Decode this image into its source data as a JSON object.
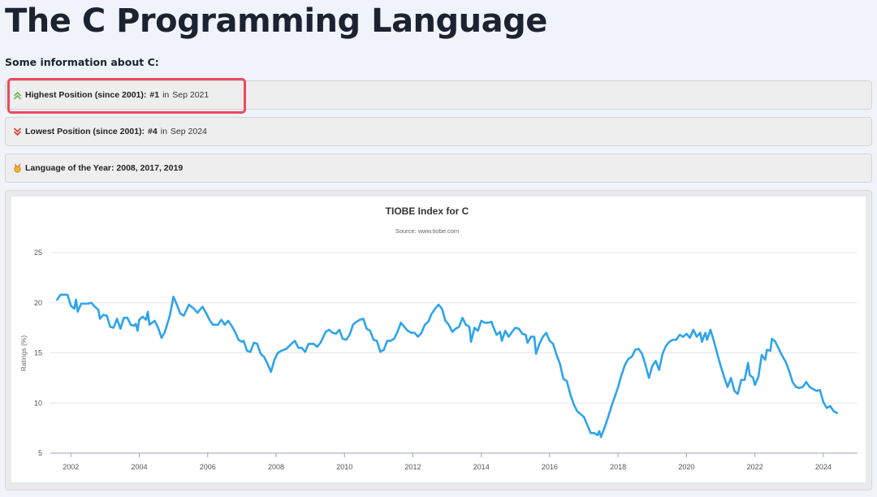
{
  "page": {
    "title": "The C Programming Language",
    "section_heading": "Some information about C:"
  },
  "info": {
    "highest": {
      "label": "Highest Position (since 2001):",
      "value": "#1",
      "in": "in",
      "date": "Sep 2021"
    },
    "lowest": {
      "label": "Lowest Position (since 2001):",
      "value": "#4",
      "in": "in",
      "date": "Sep 2024"
    },
    "year": {
      "label": "Language of the Year: 2008, 2017, 2019"
    }
  },
  "icons": {
    "highest": "double-chevron-up-icon",
    "lowest": "double-chevron-down-icon",
    "year": "medal-icon"
  },
  "colors": {
    "up": "#6cc04a",
    "down": "#e0463b",
    "line": "#2ea4ec",
    "highlight": "#ec4a5d"
  },
  "chart_data": {
    "type": "line",
    "title": "TIOBE Index for C",
    "subtitle": "Source: www.tiobe.com",
    "ylabel": "Ratings (%)",
    "xlabel": "",
    "ylim": [
      5,
      25
    ],
    "xlim": [
      2001.4,
      2025.0
    ],
    "yticks": [
      5,
      10,
      15,
      20,
      25
    ],
    "xticks": [
      2002,
      2004,
      2006,
      2008,
      2010,
      2012,
      2014,
      2016,
      2018,
      2020,
      2022,
      2024
    ],
    "grid": true,
    "series": [
      {
        "name": "",
        "points": [
          [
            2001.6,
            20.3
          ],
          [
            2001.7,
            20.8
          ],
          [
            2001.9,
            20.8
          ],
          [
            2002.0,
            19.7
          ],
          [
            2002.1,
            19.4
          ],
          [
            2002.15,
            20.3
          ],
          [
            2002.2,
            19.1
          ],
          [
            2002.3,
            19.9
          ],
          [
            2002.5,
            19.9
          ],
          [
            2002.6,
            20.0
          ],
          [
            2002.7,
            19.6
          ],
          [
            2002.8,
            19.3
          ],
          [
            2002.85,
            18.4
          ],
          [
            2002.95,
            18.8
          ],
          [
            2003.05,
            18.7
          ],
          [
            2003.15,
            17.6
          ],
          [
            2003.25,
            17.5
          ],
          [
            2003.35,
            18.4
          ],
          [
            2003.45,
            17.4
          ],
          [
            2003.55,
            18.5
          ],
          [
            2003.65,
            18.5
          ],
          [
            2003.75,
            17.8
          ],
          [
            2003.85,
            17.7
          ],
          [
            2003.9,
            17.9
          ],
          [
            2003.95,
            17.2
          ],
          [
            2004.0,
            18.3
          ],
          [
            2004.1,
            18.6
          ],
          [
            2004.2,
            18.3
          ],
          [
            2004.25,
            19.1
          ],
          [
            2004.3,
            17.8
          ],
          [
            2004.45,
            18.2
          ],
          [
            2004.55,
            17.5
          ],
          [
            2004.65,
            16.5
          ],
          [
            2004.75,
            17.1
          ],
          [
            2004.9,
            18.8
          ],
          [
            2005.0,
            20.6
          ],
          [
            2005.1,
            19.8
          ],
          [
            2005.2,
            18.9
          ],
          [
            2005.3,
            18.7
          ],
          [
            2005.45,
            19.8
          ],
          [
            2005.6,
            19.4
          ],
          [
            2005.7,
            19.0
          ],
          [
            2005.85,
            19.6
          ],
          [
            2005.95,
            19.0
          ],
          [
            2006.05,
            18.3
          ],
          [
            2006.15,
            17.8
          ],
          [
            2006.3,
            17.8
          ],
          [
            2006.4,
            18.3
          ],
          [
            2006.5,
            17.8
          ],
          [
            2006.6,
            18.2
          ],
          [
            2006.7,
            17.7
          ],
          [
            2006.8,
            17.1
          ],
          [
            2006.9,
            16.3
          ],
          [
            2007.0,
            16.1
          ],
          [
            2007.05,
            16.2
          ],
          [
            2007.15,
            15.2
          ],
          [
            2007.25,
            15.1
          ],
          [
            2007.35,
            16.0
          ],
          [
            2007.45,
            15.9
          ],
          [
            2007.55,
            14.9
          ],
          [
            2007.65,
            14.6
          ],
          [
            2007.75,
            13.9
          ],
          [
            2007.85,
            13.1
          ],
          [
            2007.95,
            14.3
          ],
          [
            2008.05,
            15.0
          ],
          [
            2008.15,
            15.2
          ],
          [
            2008.3,
            15.4
          ],
          [
            2008.45,
            15.9
          ],
          [
            2008.55,
            16.2
          ],
          [
            2008.65,
            15.5
          ],
          [
            2008.75,
            15.5
          ],
          [
            2008.85,
            15.1
          ],
          [
            2008.95,
            15.9
          ],
          [
            2009.1,
            15.9
          ],
          [
            2009.2,
            15.6
          ],
          [
            2009.3,
            16.0
          ],
          [
            2009.45,
            17.1
          ],
          [
            2009.55,
            17.3
          ],
          [
            2009.65,
            17.0
          ],
          [
            2009.75,
            16.9
          ],
          [
            2009.85,
            17.3
          ],
          [
            2009.95,
            16.4
          ],
          [
            2010.05,
            16.3
          ],
          [
            2010.15,
            16.8
          ],
          [
            2010.25,
            17.8
          ],
          [
            2010.35,
            18.1
          ],
          [
            2010.45,
            18.3
          ],
          [
            2010.55,
            18.4
          ],
          [
            2010.65,
            17.4
          ],
          [
            2010.75,
            17.2
          ],
          [
            2010.85,
            16.3
          ],
          [
            2010.95,
            16.2
          ],
          [
            2011.05,
            15.1
          ],
          [
            2011.15,
            15.3
          ],
          [
            2011.25,
            16.2
          ],
          [
            2011.35,
            16.2
          ],
          [
            2011.45,
            16.4
          ],
          [
            2011.55,
            17.1
          ],
          [
            2011.65,
            18.0
          ],
          [
            2011.75,
            17.6
          ],
          [
            2011.85,
            17.2
          ],
          [
            2011.95,
            17.0
          ],
          [
            2012.05,
            17.0
          ],
          [
            2012.15,
            16.6
          ],
          [
            2012.25,
            17.0
          ],
          [
            2012.35,
            17.8
          ],
          [
            2012.45,
            18.1
          ],
          [
            2012.55,
            18.9
          ],
          [
            2012.65,
            19.4
          ],
          [
            2012.75,
            19.8
          ],
          [
            2012.85,
            19.4
          ],
          [
            2012.95,
            18.2
          ],
          [
            2013.05,
            17.8
          ],
          [
            2013.15,
            17.1
          ],
          [
            2013.25,
            17.4
          ],
          [
            2013.35,
            17.6
          ],
          [
            2013.45,
            18.5
          ],
          [
            2013.55,
            17.8
          ],
          [
            2013.65,
            17.6
          ],
          [
            2013.7,
            16.1
          ],
          [
            2013.8,
            17.5
          ],
          [
            2013.9,
            17.2
          ],
          [
            2014.0,
            18.2
          ],
          [
            2014.1,
            18.0
          ],
          [
            2014.2,
            18.0
          ],
          [
            2014.3,
            18.1
          ],
          [
            2014.35,
            17.6
          ],
          [
            2014.45,
            16.8
          ],
          [
            2014.55,
            17.1
          ],
          [
            2014.6,
            16.2
          ],
          [
            2014.7,
            17.2
          ],
          [
            2014.8,
            16.6
          ],
          [
            2014.9,
            17.1
          ],
          [
            2015.0,
            17.5
          ],
          [
            2015.1,
            17.4
          ],
          [
            2015.2,
            16.9
          ],
          [
            2015.3,
            16.8
          ],
          [
            2015.35,
            16.0
          ],
          [
            2015.45,
            16.6
          ],
          [
            2015.55,
            16.6
          ],
          [
            2015.6,
            14.9
          ],
          [
            2015.7,
            15.9
          ],
          [
            2015.8,
            16.6
          ],
          [
            2015.9,
            17.0
          ],
          [
            2016.0,
            16.2
          ],
          [
            2016.1,
            15.9
          ],
          [
            2016.2,
            14.8
          ],
          [
            2016.3,
            13.9
          ],
          [
            2016.4,
            12.4
          ],
          [
            2016.5,
            12.2
          ],
          [
            2016.6,
            10.9
          ],
          [
            2016.7,
            9.9
          ],
          [
            2016.8,
            9.2
          ],
          [
            2016.9,
            8.9
          ],
          [
            2017.0,
            8.6
          ],
          [
            2017.1,
            7.8
          ],
          [
            2017.2,
            7.0
          ],
          [
            2017.3,
            7.0
          ],
          [
            2017.4,
            6.8
          ],
          [
            2017.45,
            7.2
          ],
          [
            2017.5,
            6.6
          ],
          [
            2017.6,
            7.5
          ],
          [
            2017.7,
            8.5
          ],
          [
            2017.8,
            9.6
          ],
          [
            2017.9,
            10.6
          ],
          [
            2018.0,
            11.6
          ],
          [
            2018.1,
            12.8
          ],
          [
            2018.2,
            13.8
          ],
          [
            2018.3,
            14.4
          ],
          [
            2018.4,
            14.6
          ],
          [
            2018.5,
            15.3
          ],
          [
            2018.6,
            15.4
          ],
          [
            2018.7,
            14.9
          ],
          [
            2018.8,
            13.8
          ],
          [
            2018.9,
            12.5
          ],
          [
            2019.0,
            13.7
          ],
          [
            2019.1,
            14.2
          ],
          [
            2019.2,
            13.3
          ],
          [
            2019.3,
            14.9
          ],
          [
            2019.4,
            15.7
          ],
          [
            2019.5,
            16.1
          ],
          [
            2019.6,
            16.3
          ],
          [
            2019.7,
            16.3
          ],
          [
            2019.8,
            16.8
          ],
          [
            2019.9,
            16.6
          ],
          [
            2020.0,
            16.9
          ],
          [
            2020.1,
            16.5
          ],
          [
            2020.2,
            17.3
          ],
          [
            2020.3,
            16.6
          ],
          [
            2020.4,
            17.0
          ],
          [
            2020.45,
            16.1
          ],
          [
            2020.55,
            17.0
          ],
          [
            2020.6,
            16.3
          ],
          [
            2020.7,
            17.3
          ],
          [
            2020.8,
            16.2
          ],
          [
            2020.9,
            14.9
          ],
          [
            2021.0,
            13.7
          ],
          [
            2021.1,
            12.6
          ],
          [
            2021.2,
            11.6
          ],
          [
            2021.3,
            12.5
          ],
          [
            2021.4,
            11.2
          ],
          [
            2021.5,
            10.9
          ],
          [
            2021.6,
            12.3
          ],
          [
            2021.7,
            12.3
          ],
          [
            2021.8,
            14.0
          ],
          [
            2021.85,
            12.8
          ],
          [
            2021.95,
            12.5
          ],
          [
            2022.0,
            11.8
          ],
          [
            2022.1,
            12.6
          ],
          [
            2022.2,
            14.8
          ],
          [
            2022.3,
            14.3
          ],
          [
            2022.35,
            15.3
          ],
          [
            2022.45,
            15.2
          ],
          [
            2022.5,
            16.4
          ],
          [
            2022.6,
            16.1
          ],
          [
            2022.7,
            15.4
          ],
          [
            2022.8,
            14.7
          ],
          [
            2022.9,
            14.1
          ],
          [
            2023.0,
            13.2
          ],
          [
            2023.1,
            12.1
          ],
          [
            2023.2,
            11.6
          ],
          [
            2023.3,
            11.5
          ],
          [
            2023.4,
            11.6
          ],
          [
            2023.5,
            12.1
          ],
          [
            2023.6,
            11.6
          ],
          [
            2023.7,
            11.4
          ],
          [
            2023.8,
            11.2
          ],
          [
            2023.9,
            11.3
          ],
          [
            2024.0,
            10.1
          ],
          [
            2024.1,
            9.5
          ],
          [
            2024.2,
            9.7
          ],
          [
            2024.3,
            9.2
          ],
          [
            2024.4,
            9.0
          ]
        ]
      }
    ]
  }
}
